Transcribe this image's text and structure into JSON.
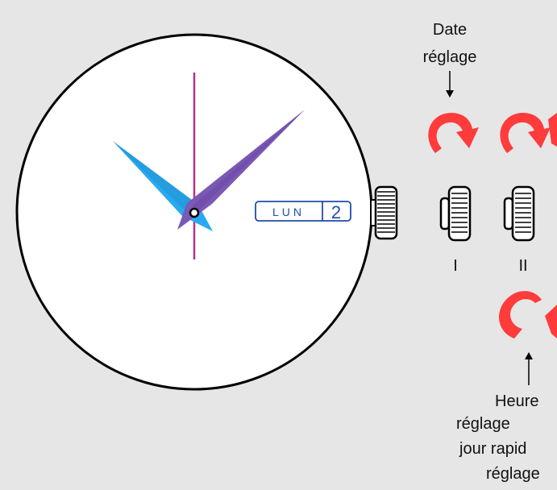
{
  "date_window": {
    "day": "LUN",
    "date": "2"
  },
  "labels": {
    "date_title": "Date",
    "date_sub": "réglage",
    "position_1": "I",
    "position_2": "II",
    "bottom_line1": "Heure",
    "bottom_line2": "réglage",
    "bottom_line3": "jour rapid",
    "bottom_line4": "réglage"
  },
  "colors": {
    "background": "#e6e6e6",
    "hour_hand": "#29a9ef",
    "minute_hand": "#7a58b5",
    "second_hand": "#b5338a",
    "arrow": "#ff3b3b",
    "date_frame": "#1e4fa8"
  },
  "icons": {
    "crown": "crown-icon",
    "rotate_arrow": "clockwise-arrow-icon"
  }
}
